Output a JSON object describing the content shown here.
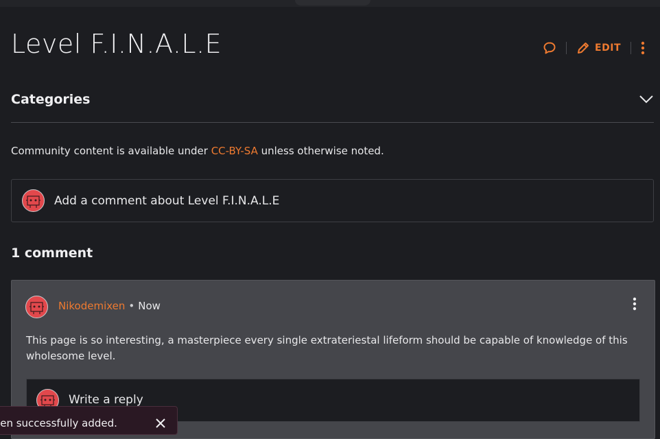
{
  "page": {
    "title": "Level F.I.N.A.L.E",
    "edit_label": "EDIT"
  },
  "categories": {
    "label": "Categories"
  },
  "license": {
    "prefix": "Community content is available under ",
    "link": "CC-BY-SA",
    "suffix": " unless otherwise noted."
  },
  "comments": {
    "add_placeholder": "Add a comment about Level F.I.N.A.L.E",
    "count_label": "1 comment",
    "items": [
      {
        "author": "Nikodemixen",
        "separator": "•",
        "time": "Now",
        "body": "This page is so interesting, a masterpiece every single extrateriestal lifeform should be capable of knowledge of this wholesome level.",
        "reply_placeholder": "Write a reply"
      }
    ]
  },
  "toast": {
    "message": "een successfully added."
  },
  "icons": {
    "discuss": "speech-bubble-icon",
    "edit": "pencil-icon",
    "more": "vertical-dots-icon",
    "expand": "chevron-down-icon",
    "close": "close-icon",
    "avatar": "robot-avatar"
  },
  "colors": {
    "accent": "#ee7a30",
    "background": "#1c1d21",
    "card": "#45464b",
    "avatar": "#e2484c"
  }
}
